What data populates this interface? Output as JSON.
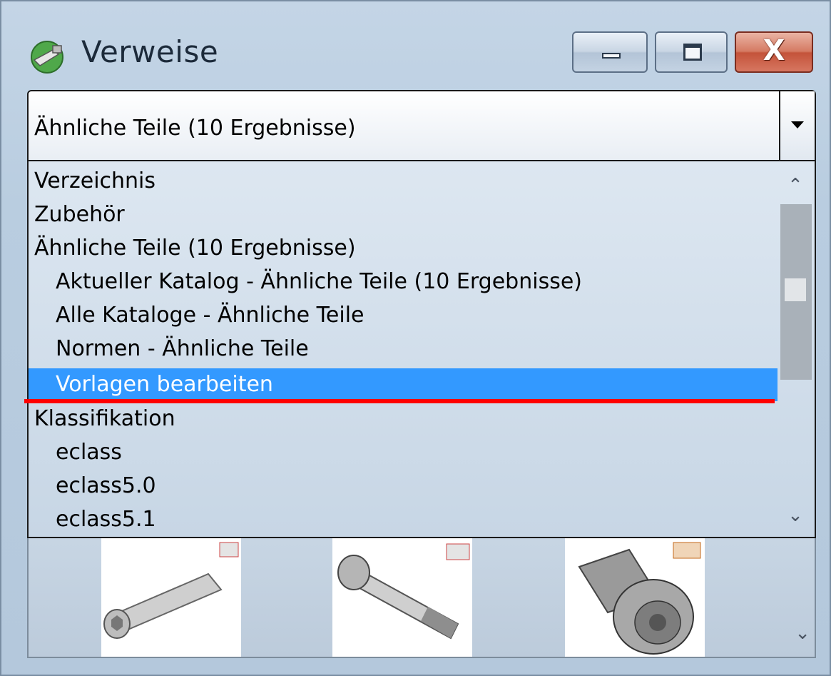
{
  "window": {
    "title": "Verweise",
    "controls": {
      "minimize": "minimize",
      "maximize": "maximize",
      "close": "X"
    }
  },
  "combo": {
    "selected_value": "Ähnliche Teile (10 Ergebnisse)"
  },
  "dropdown": {
    "items": [
      {
        "label": "Verzeichnis",
        "level": 1
      },
      {
        "label": "Zubehör",
        "level": 1
      },
      {
        "label": "Ähnliche Teile (10 Ergebnisse)",
        "level": 1
      },
      {
        "label": "Aktueller Katalog - Ähnliche Teile (10 Ergebnisse)",
        "level": 2
      },
      {
        "label": "Alle Kataloge - Ähnliche Teile",
        "level": 2
      },
      {
        "label": "Normen - Ähnliche Teile",
        "level": 2
      },
      {
        "label": "Vorlagen bearbeiten",
        "level": 2,
        "selected": true,
        "annotated": true
      },
      {
        "label": "Klassifikation",
        "level": 1
      },
      {
        "label": "eclass",
        "level": 2
      },
      {
        "label": "eclass5.0",
        "level": 2
      },
      {
        "label": "eclass5.1",
        "level": 2
      }
    ],
    "highlight_color": "#3399ff",
    "annotation_color": "#ff0000"
  },
  "thumbnails": [
    {
      "icon": "socket-head-screw-long"
    },
    {
      "icon": "flange-bolt"
    },
    {
      "icon": "socket-head-screw-short"
    }
  ],
  "icons": {
    "app": "references-icon",
    "scroll_up": "chevron-up-icon",
    "scroll_down": "chevron-down-icon"
  }
}
